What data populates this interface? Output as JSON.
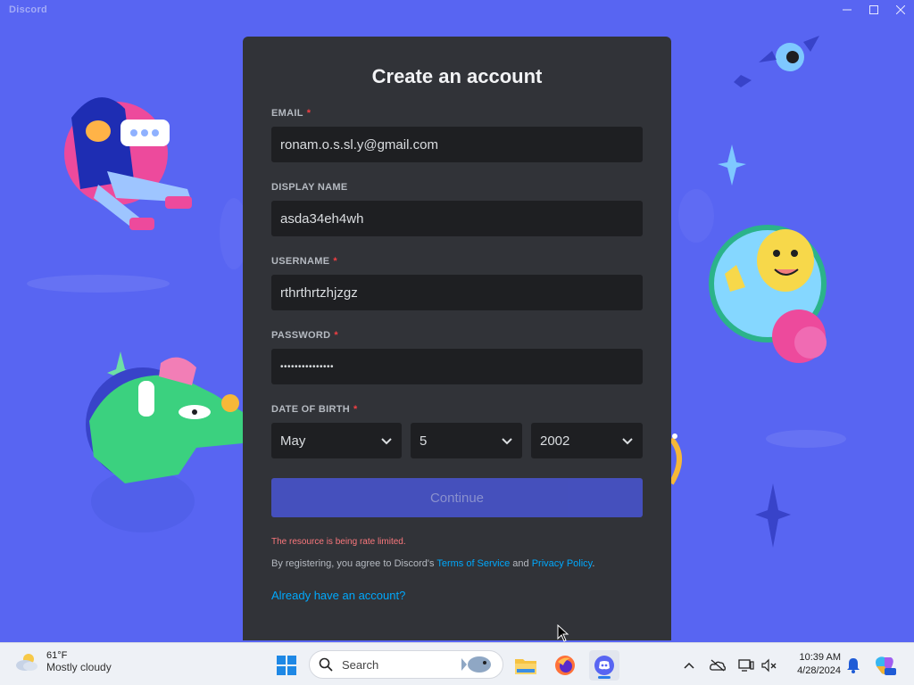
{
  "window": {
    "title": "Discord",
    "controls": [
      "minimize-icon",
      "maximize-icon",
      "close-icon"
    ]
  },
  "form": {
    "title": "Create an account",
    "email": {
      "label": "EMAIL",
      "required": "*",
      "value": "ronam.o.s.sl.y@gmail.com"
    },
    "display_name": {
      "label": "DISPLAY NAME",
      "value": "asda34eh4wh"
    },
    "username": {
      "label": "USERNAME",
      "required": "*",
      "value": "rthrthrtzhjzgz"
    },
    "password": {
      "label": "PASSWORD",
      "required": "*",
      "value": "•••••••••••••••"
    },
    "dob": {
      "label": "DATE OF BIRTH",
      "required": "*",
      "month": "May",
      "day": "5",
      "year": "2002"
    },
    "continue_label": "Continue",
    "error": "The resource is being rate limited.",
    "legal_prefix": "By registering, you agree to Discord's ",
    "terms_link": "Terms of Service",
    "legal_and": " and ",
    "privacy_link": "Privacy Policy",
    "legal_suffix": ".",
    "login_link": "Already have an account?"
  },
  "taskbar": {
    "weather": {
      "temp": "61°F",
      "condition": "Mostly cloudy",
      "icon": "partly-cloudy-icon"
    },
    "search_label": "Search",
    "apps": [
      "windows-start-icon",
      "file-explorer-icon",
      "firefox-icon",
      "discord-icon"
    ],
    "clock": {
      "time": "10:39 AM",
      "date": "4/28/2024"
    },
    "tray_icons": [
      "chevron-up-icon",
      "onedrive-icon",
      "display-icon",
      "volume-muted-icon",
      "notification-bell-icon",
      "copilot-icon"
    ]
  },
  "colors": {
    "blurple": "#5865f2",
    "modal_bg": "#313338",
    "input_bg": "#1e1f22",
    "link": "#00a8fc",
    "error": "#fa777c",
    "required": "#f23f43"
  }
}
